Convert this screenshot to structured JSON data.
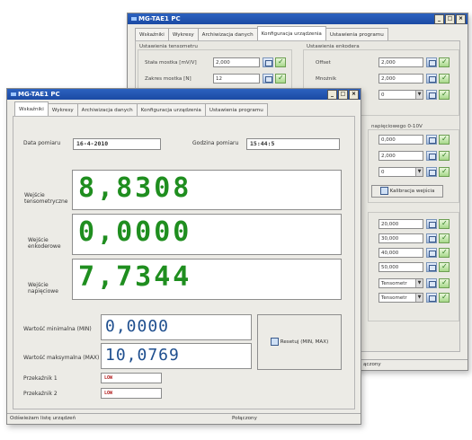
{
  "colors": {
    "title_bar": "#1b4aa3",
    "value_green": "#1f8e1f",
    "value_blue": "#1f4f8f",
    "relay_red": "#b21d1d"
  },
  "back_window": {
    "title": "MG-TAE1 PC",
    "tabs": [
      "Wskaźniki",
      "Wykresy",
      "Archiwizacja danych",
      "Konfiguracja urządzenia",
      "Ustawienia programu"
    ],
    "active_tab": "Konfiguracja urządzenia",
    "left_group": {
      "title": "Ustawienia tensometru",
      "rows": [
        {
          "label": "Stała mostka [mV/V]",
          "value": "2,000"
        },
        {
          "label": "Zakres mostka [N]",
          "value": "12"
        }
      ]
    },
    "right_group": {
      "title": "Ustawienia enkodera",
      "rows": [
        {
          "label": "Offset",
          "value": "2,000"
        },
        {
          "label": "Mnożnik",
          "value": "2,000"
        },
        {
          "label": "",
          "value": "0"
        }
      ]
    },
    "voltage_group_title": "napięciowego 0-10V",
    "voltage_rows": [
      "0,000",
      "2,000",
      "0"
    ],
    "calibrate_button": "Kalibracja wejścia",
    "list_rows": [
      "20,000",
      "30,000",
      "40,000",
      "50,000"
    ],
    "dropdown_rows": [
      "Tensometr",
      "Tensometr"
    ],
    "status_text": "ączony"
  },
  "front_window": {
    "title": "MG-TAE1 PC",
    "tabs": [
      "Wskaźniki",
      "Wykresy",
      "Archiwizacja danych",
      "Konfiguracja urządzenia",
      "Ustawienia programu"
    ],
    "active_tab": "Wskaźniki",
    "date_label": "Data pomiaru",
    "date_value": "16-4-2010",
    "time_label": "Godzina pomiaru",
    "time_value": "15:44:5",
    "readings": [
      {
        "label": "Wejście tensometryczne",
        "value": "8,8308"
      },
      {
        "label": "Wejście enkoderowe",
        "value": "0,0000"
      },
      {
        "label": "Wejście napięciowe",
        "value": "7,7344"
      }
    ],
    "min_label": "Wartość minimalna (MIN)",
    "min_value": "0,0000",
    "max_label": "Wartość maksymalna (MAX)",
    "max_value": "10,0769",
    "reset_button": "Resetuj (MIN, MAX)",
    "relays": [
      {
        "label": "Przekaźnik 1",
        "value": "LOW"
      },
      {
        "label": "Przekaźnik 2",
        "value": "LOW"
      }
    ],
    "status_left": "Odświeżam listę urządzeń",
    "status_right": "Połączony"
  }
}
